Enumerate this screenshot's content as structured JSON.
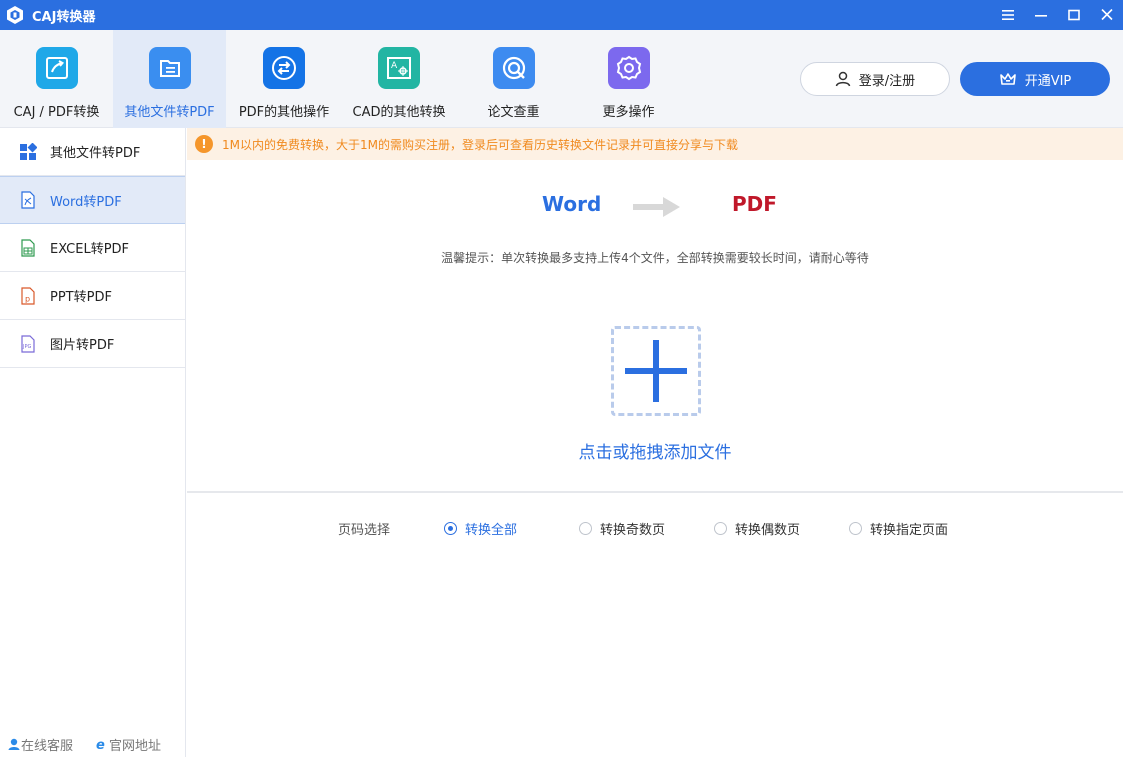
{
  "window": {
    "title": "CAJ转换器",
    "controls": [
      "menu-icon",
      "minimize-icon",
      "maximize-icon",
      "close-icon"
    ]
  },
  "toolbar": {
    "items": [
      {
        "label": "CAJ / PDF转换",
        "icon": "caj-pdf-convert-icon",
        "color": "#1fa8e8",
        "active": false
      },
      {
        "label": "其他文件转PDF",
        "icon": "folder-file-icon",
        "color": "#3a8ef0",
        "active": true
      },
      {
        "label": "PDF的其他操作",
        "icon": "swap-arrows-icon",
        "color": "#1473e6",
        "active": false
      },
      {
        "label": "CAD的其他转换",
        "icon": "cad-drawing-icon",
        "color": "#22b5a3",
        "active": false
      },
      {
        "label": "论文查重",
        "icon": "search-check-icon",
        "color": "#3d8bf0",
        "active": false
      },
      {
        "label": "更多操作",
        "icon": "gear-icon",
        "color": "#7c69ee",
        "active": false
      }
    ],
    "login_label": "登录/注册",
    "vip_label": "开通VIP"
  },
  "sidebar": {
    "items": [
      {
        "label": "其他文件转PDF",
        "icon": "grid-apps-icon",
        "active": false
      },
      {
        "label": "Word转PDF",
        "icon": "word-file-icon",
        "active": true
      },
      {
        "label": "EXCEL转PDF",
        "icon": "excel-file-icon",
        "active": false
      },
      {
        "label": "PPT转PDF",
        "icon": "ppt-file-icon",
        "active": false
      },
      {
        "label": "图片转PDF",
        "icon": "jpg-file-icon",
        "active": false
      }
    ],
    "footer": {
      "support_label": "在线客服",
      "website_label": "官网地址"
    }
  },
  "notice": {
    "text": "1M以内的免费转换，大于1M的需购买注册，登录后可查看历史转换文件记录并可直接分享与下载"
  },
  "conversion": {
    "from": "Word",
    "to": "PDF",
    "hint": "温馨提示：单次转换最多支持上传4个文件，全部转换需要较长时间，请耐心等待",
    "drop_label": "点击或拖拽添加文件"
  },
  "pages": {
    "label": "页码选择",
    "options": [
      {
        "label": "转换全部",
        "checked": true
      },
      {
        "label": "转换奇数页",
        "checked": false
      },
      {
        "label": "转换偶数页",
        "checked": false
      },
      {
        "label": "转换指定页面",
        "checked": false
      }
    ]
  },
  "colors": {
    "brand": "#2b6fe0",
    "pdf_red": "#c0182a",
    "notice_orange": "#f08a1f"
  }
}
